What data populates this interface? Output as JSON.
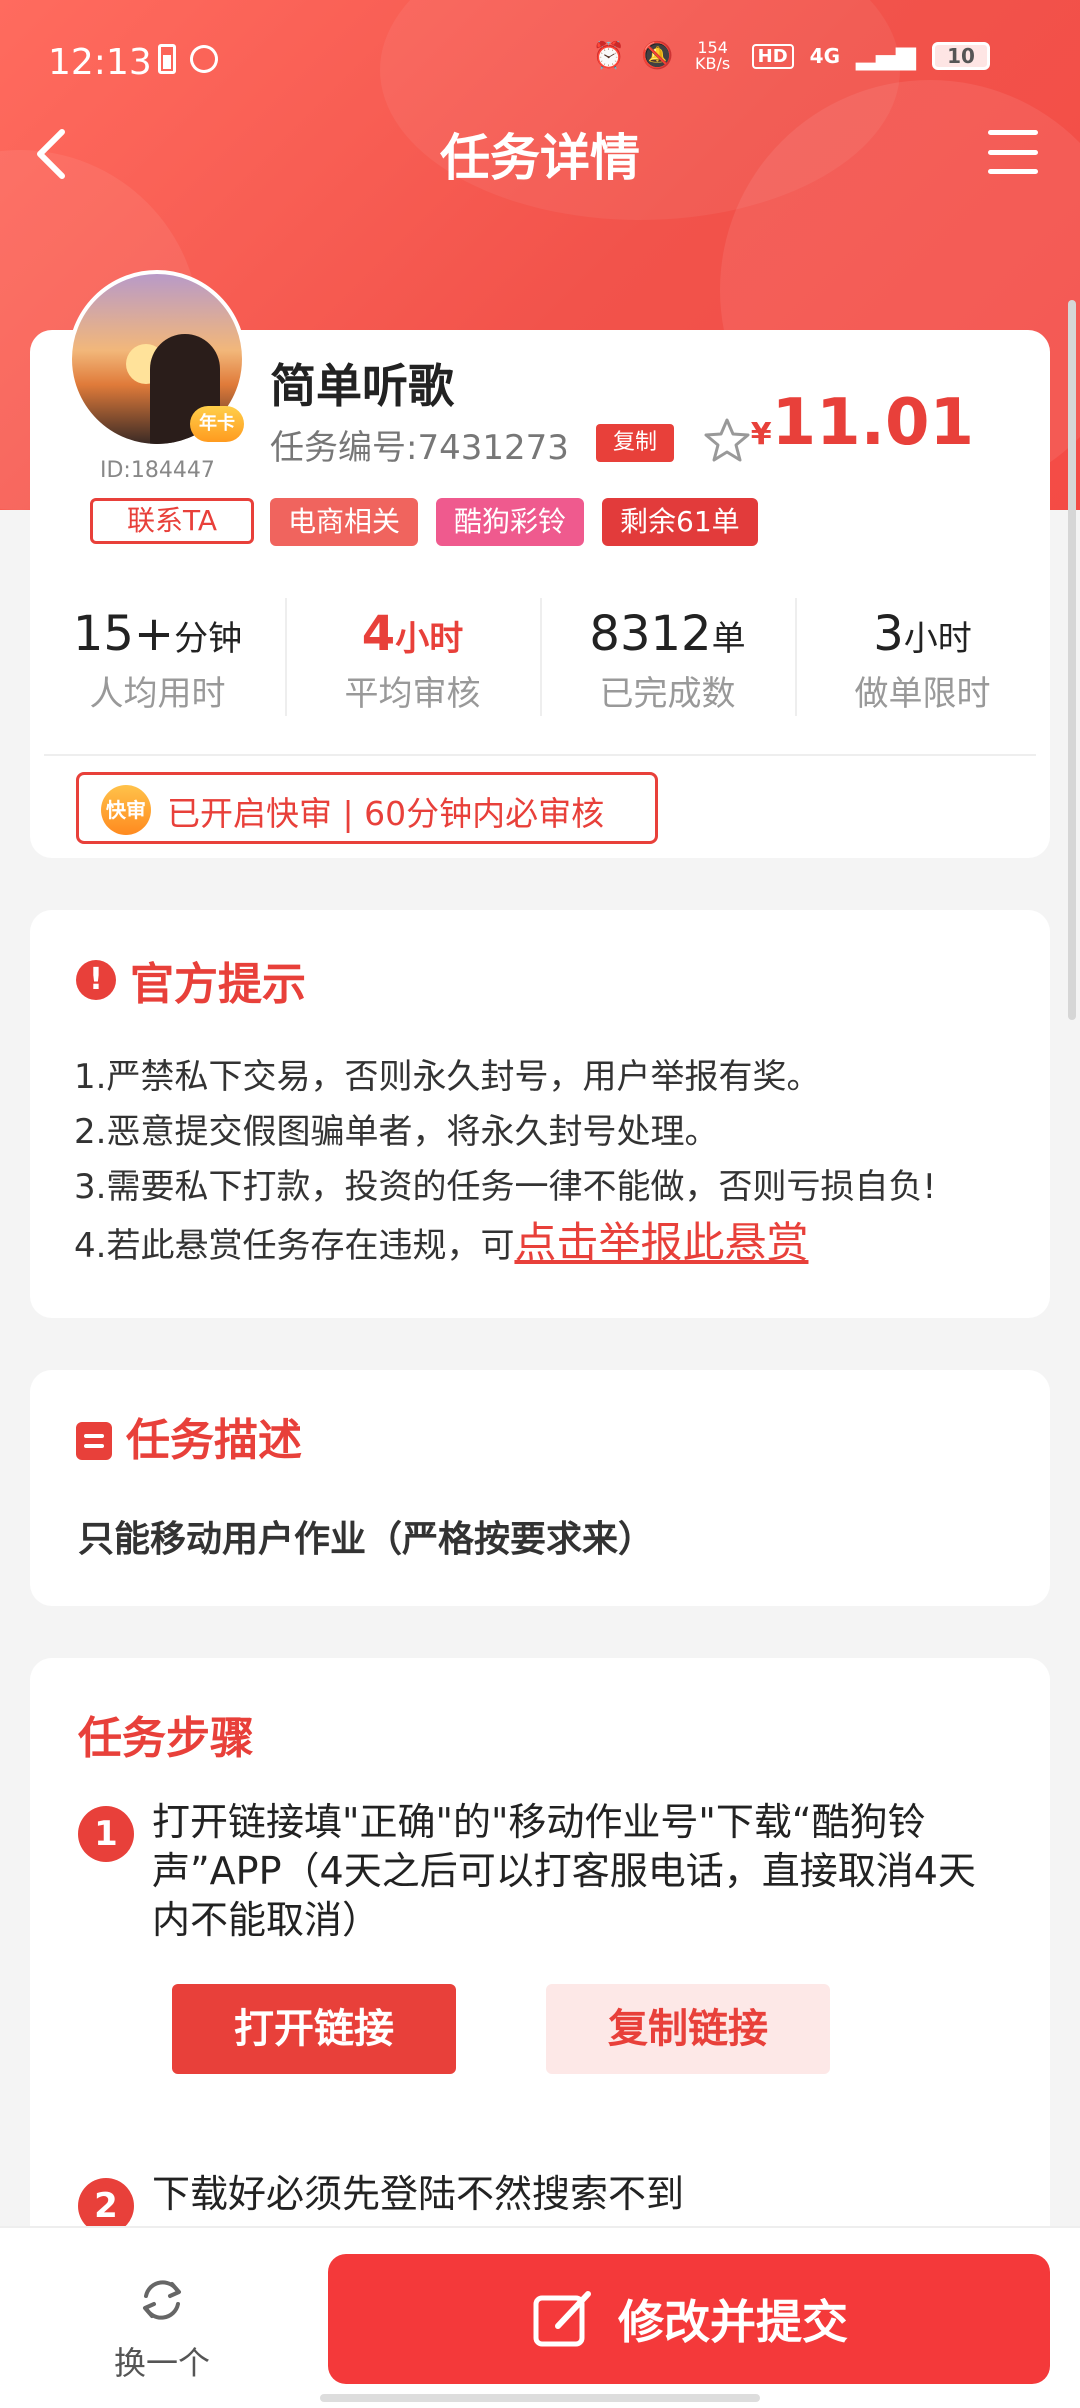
{
  "status": {
    "time": "12:13",
    "net_speed": "154 KB/s",
    "hd": "HD",
    "signal": "4G",
    "battery": "10"
  },
  "nav": {
    "title": "任务详情"
  },
  "task": {
    "name": "简单听歌",
    "id_label": "ID:184447",
    "task_number": "任务编号:7431273",
    "copy": "复制",
    "contact": "联系TA",
    "crown": "年卡",
    "price_currency": "¥",
    "price": "11.01",
    "tags": [
      {
        "label": "电商相关",
        "color": "#f0645e"
      },
      {
        "label": "酷狗彩铃",
        "color": "#ef5a8e"
      },
      {
        "label": "剩余61单",
        "color": "#e23b3b"
      }
    ],
    "stats": [
      {
        "value": "15+",
        "unit": "分钟",
        "label": "人均用时"
      },
      {
        "value": "4",
        "unit": "小时",
        "label": "平均审核"
      },
      {
        "value": "8312",
        "unit": "单",
        "label": "已完成数"
      },
      {
        "value": "3",
        "unit": "小时",
        "label": "做单限时"
      }
    ],
    "fast_badge": "快审",
    "fast_text": "已开启快审 | 60分钟内必审核"
  },
  "notice": {
    "title": "官方提示",
    "lines": [
      "1.严禁私下交易，否则永久封号，用户举报有奖。",
      "2.恶意提交假图骗单者，将永久封号处理。",
      "3.需要私下打款，投资的任务一律不能做，否则亏损自负!",
      "4.若此悬赏任务存在违规，可"
    ],
    "report_link": "点击举报此悬赏"
  },
  "description": {
    "title": "任务描述",
    "text": "只能移动用户作业（严格按要求来）"
  },
  "steps": {
    "title": "任务步骤",
    "items": [
      {
        "num": "1",
        "text": "打开链接填\"正确\"的\"移动作业号\"下载“酷狗铃声”APP（4天之后可以打客服电话，直接取消4天内不能取消）"
      },
      {
        "num": "2",
        "text": "下载好必须先登陆不然搜索不到"
      }
    ],
    "open_link": "打开链接",
    "copy_link": "复制链接"
  },
  "bottom": {
    "swap": "换一个",
    "submit": "修改并提交"
  }
}
